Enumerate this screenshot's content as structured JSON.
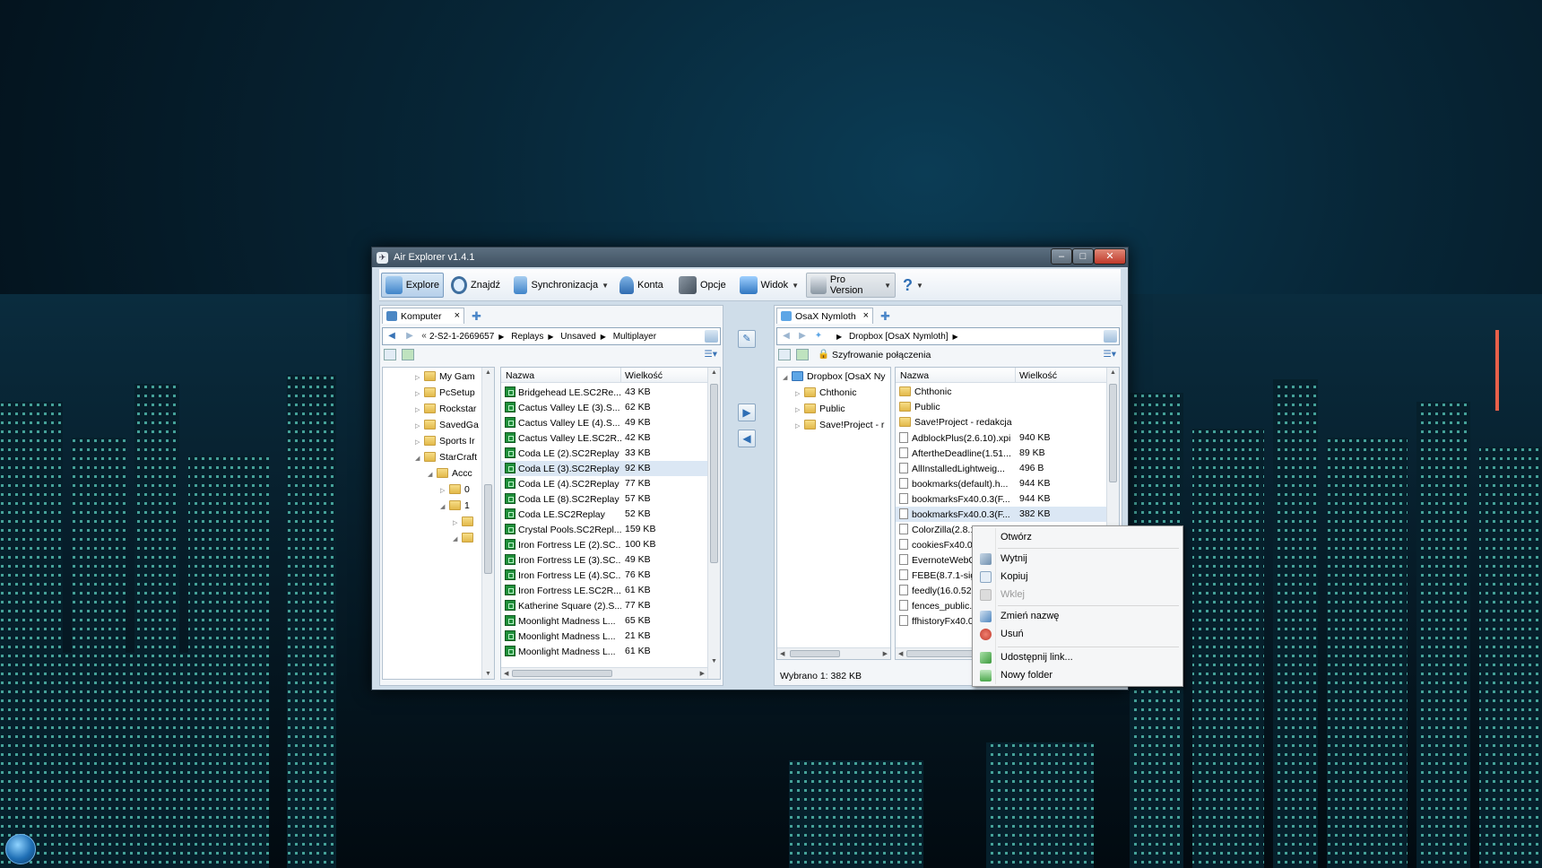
{
  "window": {
    "title": "Air Explorer v1.4.1"
  },
  "toolbar": {
    "explore": "Explore",
    "find": "Znajdź",
    "sync": "Synchronizacja",
    "accounts": "Konta",
    "options": "Opcje",
    "view": "Widok",
    "pro": "Pro Version",
    "help": "?"
  },
  "left": {
    "tab": "Komputer",
    "crumbs": [
      "2-S2-1-2669657",
      "Replays",
      "Unsaved",
      "Multiplayer"
    ],
    "tree": [
      {
        "label": "My Gam",
        "level": 0
      },
      {
        "label": "PcSetup",
        "level": 0
      },
      {
        "label": "Rockstar",
        "level": 0
      },
      {
        "label": "SavedGa",
        "level": 0
      },
      {
        "label": "Sports Ir",
        "level": 0
      },
      {
        "label": "StarCraft",
        "level": 0
      },
      {
        "label": "Accc",
        "level": 1
      },
      {
        "label": "0",
        "level": 2
      },
      {
        "label": "1",
        "level": 2
      },
      {
        "label": "",
        "level": 3
      },
      {
        "label": "",
        "level": 3
      }
    ],
    "columns": {
      "name": "Nazwa",
      "size": "Wielkość"
    },
    "files": [
      {
        "name": "Bridgehead LE.SC2Re...",
        "size": "43 KB"
      },
      {
        "name": "Cactus Valley LE (3).S...",
        "size": "62 KB"
      },
      {
        "name": "Cactus Valley LE (4).S...",
        "size": "49 KB"
      },
      {
        "name": "Cactus Valley LE.SC2R...",
        "size": "42 KB"
      },
      {
        "name": "Coda LE (2).SC2Replay",
        "size": "33 KB"
      },
      {
        "name": "Coda LE (3).SC2Replay",
        "size": "92 KB"
      },
      {
        "name": "Coda LE (4).SC2Replay",
        "size": "77 KB"
      },
      {
        "name": "Coda LE (8).SC2Replay",
        "size": "57 KB"
      },
      {
        "name": "Coda LE.SC2Replay",
        "size": "52 KB"
      },
      {
        "name": "Crystal Pools.SC2Repl...",
        "size": "159 KB"
      },
      {
        "name": "Iron Fortress LE (2).SC...",
        "size": "100 KB"
      },
      {
        "name": "Iron Fortress LE (3).SC...",
        "size": "49 KB"
      },
      {
        "name": "Iron Fortress LE (4).SC...",
        "size": "76 KB"
      },
      {
        "name": "Iron Fortress LE.SC2R...",
        "size": "61 KB"
      },
      {
        "name": "Katherine Square (2).S...",
        "size": "77 KB"
      },
      {
        "name": "Moonlight Madness L...",
        "size": "65 KB"
      },
      {
        "name": "Moonlight Madness L...",
        "size": "21 KB"
      },
      {
        "name": "Moonlight Madness L...",
        "size": "61 KB"
      }
    ]
  },
  "right": {
    "tab": "OsaX Nymloth",
    "crumbs": [
      "Dropbox [OsaX Nymloth]"
    ],
    "encryption": "Szyfrowanie połączenia",
    "tree": [
      {
        "label": "Dropbox [OsaX Ny",
        "level": 0
      },
      {
        "label": "Chthonic",
        "level": 1
      },
      {
        "label": "Public",
        "level": 1
      },
      {
        "label": "Save!Project - r",
        "level": 1
      }
    ],
    "columns": {
      "name": "Nazwa",
      "size": "Wielkość"
    },
    "files": [
      {
        "name": "Chthonic",
        "size": "",
        "type": "folder"
      },
      {
        "name": "Public",
        "size": "",
        "type": "folder"
      },
      {
        "name": "Save!Project - redakcja",
        "size": "",
        "type": "folder"
      },
      {
        "name": "AdblockPlus(2.6.10).xpi",
        "size": "940 KB",
        "type": "file"
      },
      {
        "name": "AftertheDeadline(1.51...",
        "size": "89 KB",
        "type": "file"
      },
      {
        "name": "AllInstalledLightweig...",
        "size": "496 B",
        "type": "file"
      },
      {
        "name": "bookmarks(default).h...",
        "size": "944 KB",
        "type": "file"
      },
      {
        "name": "bookmarksFx40.0.3(F...",
        "size": "944 KB",
        "type": "file"
      },
      {
        "name": "bookmarksFx40.0.3(F...",
        "size": "382 KB",
        "type": "file"
      },
      {
        "name": "ColorZilla(2.8.1",
        "size": "",
        "type": "file"
      },
      {
        "name": "cookiesFx40.0.3",
        "size": "",
        "type": "file"
      },
      {
        "name": "EvernoteWebC",
        "size": "",
        "type": "file"
      },
      {
        "name": "FEBE(8.7.1-sigr",
        "size": "",
        "type": "file"
      },
      {
        "name": "feedly(16.0.528",
        "size": "",
        "type": "file"
      },
      {
        "name": "fences_public.c",
        "size": "",
        "type": "file"
      },
      {
        "name": "ffhistoryFx40.0.",
        "size": "",
        "type": "file"
      }
    ],
    "status": "Wybrano 1: 382 KB"
  },
  "context_menu": {
    "open": "Otwórz",
    "cut": "Wytnij",
    "copy": "Kopiuj",
    "paste": "Wklej",
    "rename": "Zmień nazwę",
    "delete": "Usuń",
    "share": "Udostępnij link...",
    "new_folder": "Nowy folder"
  },
  "colors": {
    "accent": "#3a74b6",
    "selection": "#dbe7f4",
    "sc2_icon": "#1f8f3a"
  }
}
